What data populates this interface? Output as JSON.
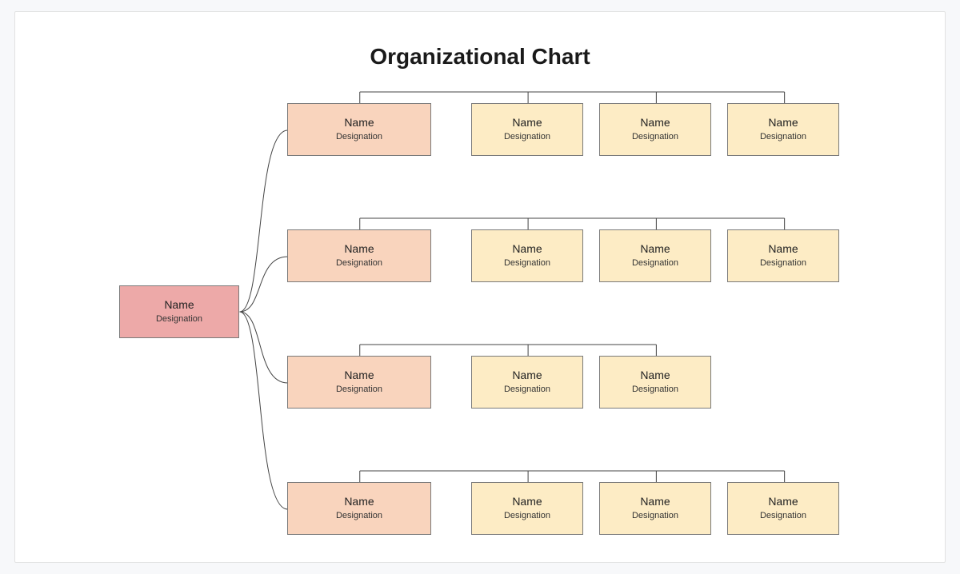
{
  "title": "Organizational Chart",
  "colors": {
    "root": "#eda9a8",
    "level1": "#f9d4bd",
    "level2": "#fdecc5"
  },
  "root": {
    "name": "Name",
    "designation": "Designation"
  },
  "branches": [
    {
      "lead": {
        "name": "Name",
        "designation": "Designation"
      },
      "children": [
        {
          "name": "Name",
          "designation": "Designation"
        },
        {
          "name": "Name",
          "designation": "Designation"
        },
        {
          "name": "Name",
          "designation": "Designation"
        }
      ]
    },
    {
      "lead": {
        "name": "Name",
        "designation": "Designation"
      },
      "children": [
        {
          "name": "Name",
          "designation": "Designation"
        },
        {
          "name": "Name",
          "designation": "Designation"
        },
        {
          "name": "Name",
          "designation": "Designation"
        }
      ]
    },
    {
      "lead": {
        "name": "Name",
        "designation": "Designation"
      },
      "children": [
        {
          "name": "Name",
          "designation": "Designation"
        },
        {
          "name": "Name",
          "designation": "Designation"
        }
      ]
    },
    {
      "lead": {
        "name": "Name",
        "designation": "Designation"
      },
      "children": [
        {
          "name": "Name",
          "designation": "Designation"
        },
        {
          "name": "Name",
          "designation": "Designation"
        },
        {
          "name": "Name",
          "designation": "Designation"
        }
      ]
    }
  ]
}
